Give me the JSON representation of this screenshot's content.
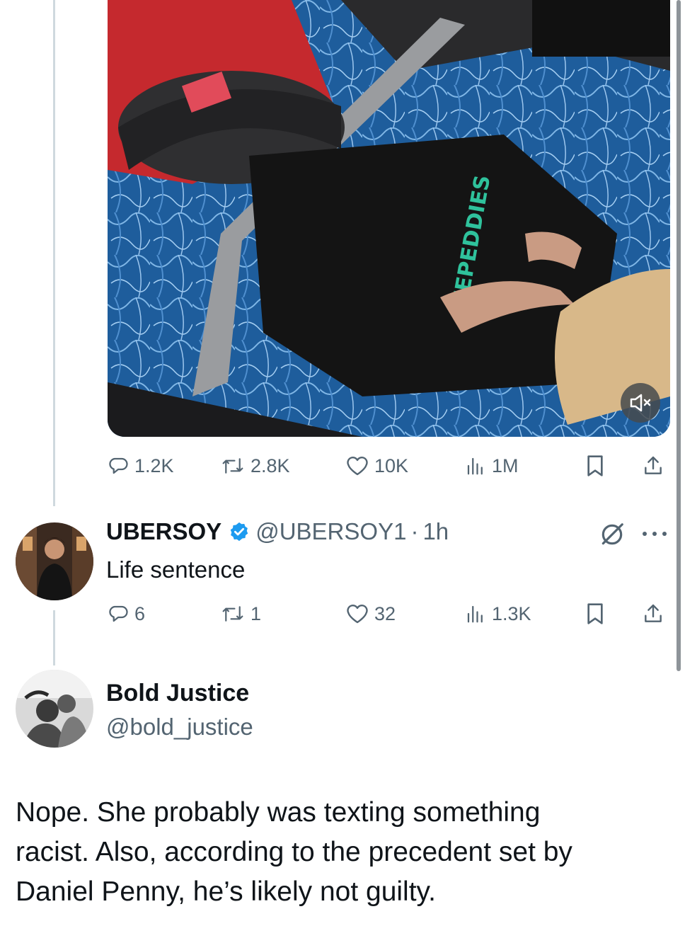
{
  "main_tweet": {
    "media": {
      "type": "video",
      "shirt_text": "ZEPEDDIES",
      "mute_icon": "speaker-muted-icon"
    },
    "actions": {
      "replies": "1.2K",
      "reposts": "2.8K",
      "likes": "10K",
      "views": "1M"
    }
  },
  "reply": {
    "display_name": "UBERSOY",
    "handle": "@UBERSOY1",
    "separator": "·",
    "time": "1h",
    "text": "Life sentence",
    "actions": {
      "replies": "6",
      "reposts": "1",
      "likes": "32",
      "views": "1.3K"
    }
  },
  "quoted_post": {
    "display_name": "Bold Justice",
    "handle": "@bold_justice",
    "body_lines": [
      "Nope. She probably was texting something",
      "racist. Also, according to the precedent set by",
      "Daniel Penny, he’s likely not guilty."
    ]
  },
  "colors": {
    "text_primary": "#0f1419",
    "text_secondary": "#536471",
    "verified_blue": "#1d9bf0",
    "thread_line": "#cfd9de"
  }
}
